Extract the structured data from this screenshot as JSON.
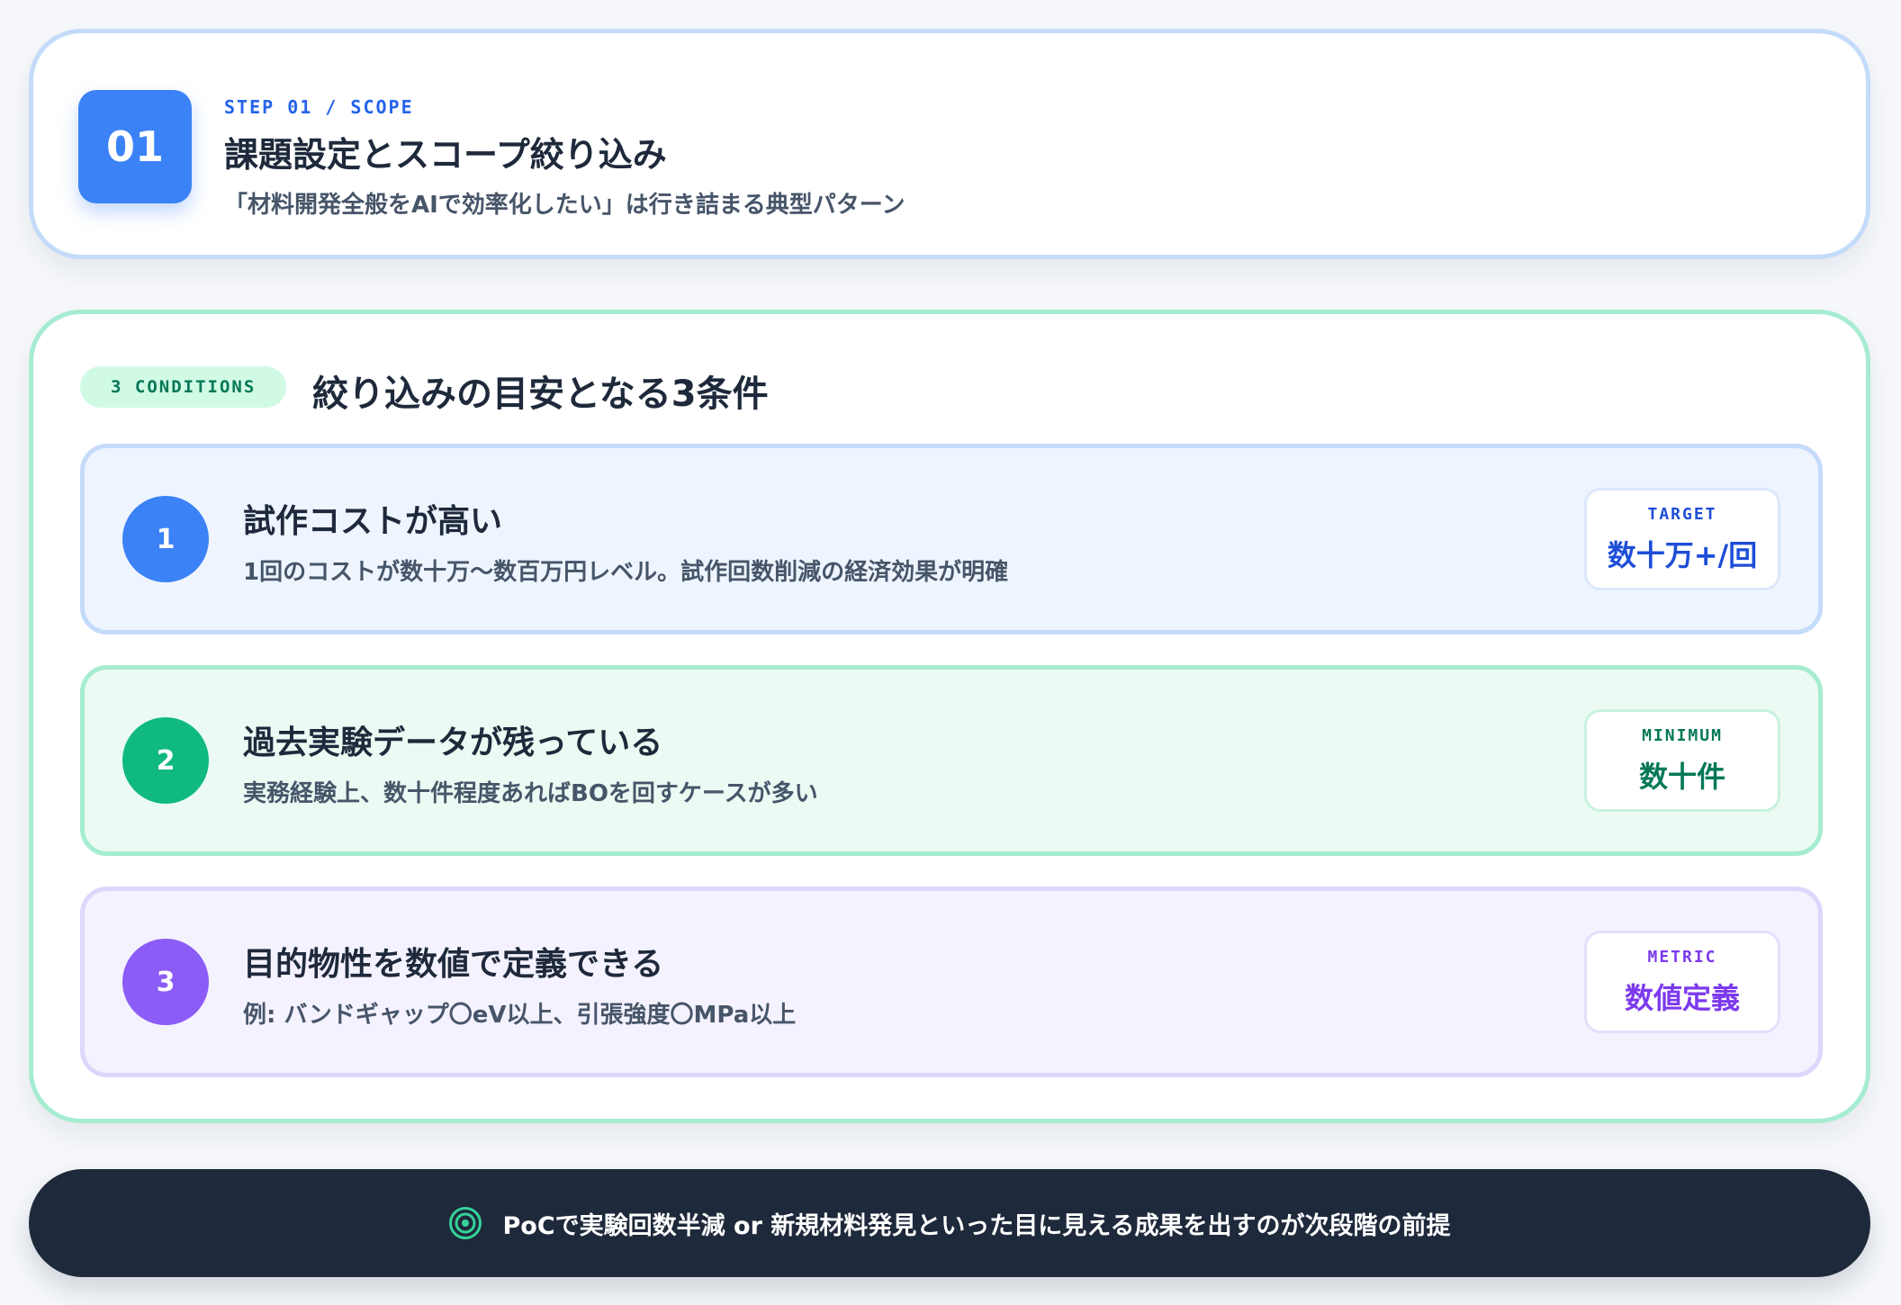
{
  "header": {
    "step_number": "01",
    "eyebrow": "STEP 01 / SCOPE",
    "title": "課題設定とスコープ絞り込み",
    "subtitle": "「材料開発全般をAIで効率化したい」は行き詰まる典型パターン"
  },
  "conditions": {
    "pill_label": "3 CONDITIONS",
    "title": "絞り込みの目安となる3条件",
    "items": [
      {
        "number": "1",
        "title": "試作コストが高い",
        "description": "1回のコストが数十万〜数百万円レベル。試作回数削減の経済効果が明確",
        "metric_label": "TARGET",
        "metric_value": "数十万+/回",
        "accent_color": "#3b82f6"
      },
      {
        "number": "2",
        "title": "過去実験データが残っている",
        "description": "実務経験上、数十件程度あればBOを回すケースが多い",
        "metric_label": "MINIMUM",
        "metric_value": "数十件",
        "accent_color": "#10b981"
      },
      {
        "number": "3",
        "title": "目的物性を数値で定義できる",
        "description": "例: バンドギャップ〇eV以上、引張強度〇MPa以上",
        "metric_label": "METRIC",
        "metric_value": "数値定義",
        "accent_color": "#8b5cf6"
      }
    ]
  },
  "footer": {
    "icon": "target-icon",
    "text": "PoCで実験回数半減 or 新規材料発見といった目に見える成果を出すのが次段階の前提"
  },
  "colors": {
    "primary_blue": "#3b82f6",
    "primary_green": "#10b981",
    "primary_purple": "#8b5cf6",
    "footer_bg": "#1e293b"
  }
}
